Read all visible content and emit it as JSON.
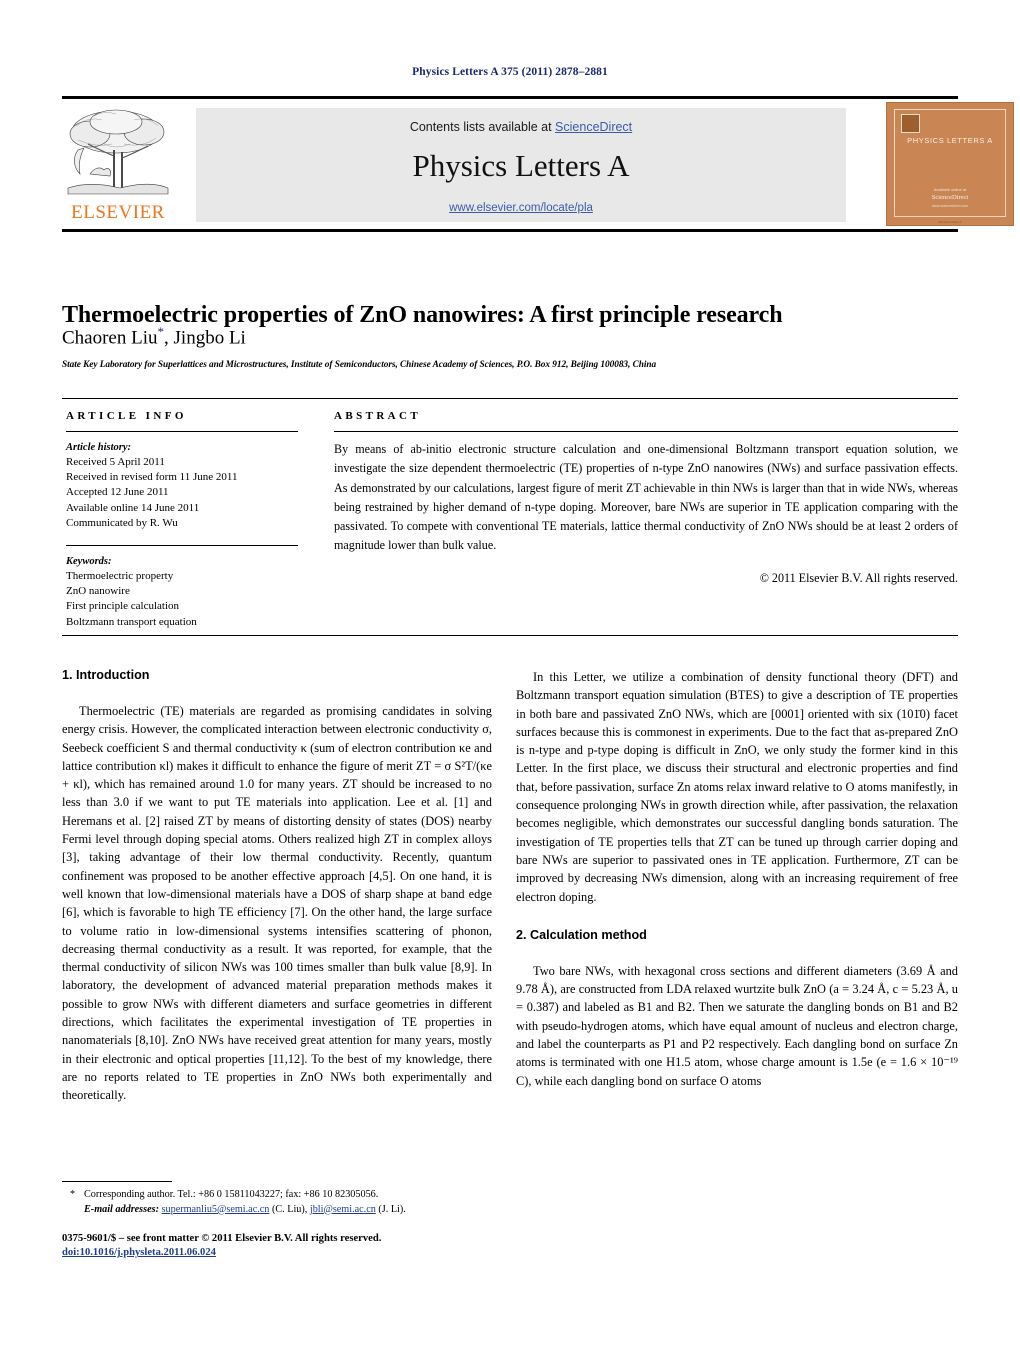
{
  "running_head": "Physics Letters A 375 (2011) 2878–2881",
  "header": {
    "contents_prefix": "Contents lists available at ",
    "sciencedirect": "ScienceDirect",
    "journal_title": "Physics Letters A",
    "journal_url": "www.elsevier.com/locate/pla",
    "publisher_wordmark": "ELSEVIER",
    "cover": {
      "title": "PHYSICS LETTERS A",
      "foot1": "Available online at",
      "foot2": "ScienceDirect",
      "foot3": "www.sciencedirect.com",
      "bottom_bar": "Physics Letters A"
    },
    "accent_color": "#3b5aa8",
    "elsevier_orange": "#e87722",
    "band_gray": "#e8e8e8",
    "cover_orange": "#c98553"
  },
  "article": {
    "title": "Thermoelectric properties of ZnO nanowires: A first principle research",
    "authors": "Chaoren Liu",
    "corresponding_marker": "*",
    "authors_rest": ", Jingbo Li",
    "affiliation": "State Key Laboratory for Superlattices and Microstructures, Institute of Semiconductors, Chinese Academy of Sciences, P.O. Box 912, Beijing 100083, China"
  },
  "article_info": {
    "heading": "ARTICLE INFO",
    "history_label": "Article history:",
    "history": [
      "Received 5 April 2011",
      "Received in revised form 11 June 2011",
      "Accepted 12 June 2011",
      "Available online 14 June 2011",
      "Communicated by R. Wu"
    ],
    "keywords_label": "Keywords:",
    "keywords": [
      "Thermoelectric property",
      "ZnO nanowire",
      "First principle calculation",
      "Boltzmann transport equation"
    ]
  },
  "abstract": {
    "heading": "ABSTRACT",
    "text": "By means of ab-initio electronic structure calculation and one-dimensional Boltzmann transport equation solution, we investigate the size dependent thermoelectric (TE) properties of n-type ZnO nanowires (NWs) and surface passivation effects. As demonstrated by our calculations, largest figure of merit ZT achievable in thin NWs is larger than that in wide NWs, whereas being restrained by higher demand of n-type doping. Moreover, bare NWs are superior in TE application comparing with the passivated. To compete with conventional TE materials, lattice thermal conductivity of ZnO NWs should be at least 2 orders of magnitude lower than bulk value.",
    "copyright": "© 2011 Elsevier B.V. All rights reserved."
  },
  "sections": {
    "introduction_heading": "1. Introduction",
    "intro_p1": "Thermoelectric (TE) materials are regarded as promising candidates in solving energy crisis. However, the complicated interaction between electronic conductivity σ, Seebeck coefficient S and thermal conductivity κ (sum of electron contribution κe and lattice contribution κl) makes it difficult to enhance the figure of merit ZT = σ S²T/(κe + κl), which has remained around 1.0 for many years. ZT should be increased to no less than 3.0 if we want to put TE materials into application. Lee et al. [1] and Heremans et al. [2] raised ZT by means of distorting density of states (DOS) nearby Fermi level through doping special atoms. Others realized high ZT in complex alloys [3], taking advantage of their low thermal conductivity. Recently, quantum confinement was proposed to be another effective approach [4,5]. On one hand, it is well known that low-dimensional materials have a DOS of sharp shape at band edge [6], which is favorable to high TE efficiency [7]. On the other hand, the large surface to volume ratio in low-dimensional systems intensifies scattering of phonon, decreasing thermal conductivity as a result. It was reported, for example, that the thermal conductivity of silicon NWs was 100 times smaller than bulk value [8,9]. In laboratory, the development of advanced material preparation methods makes it possible to grow NWs with different diameters and surface geometries in different directions, which facilitates the experimental investigation of TE properties in nanomaterials [8,10]. ZnO NWs have received great attention for many years, mostly in their electronic and optical properties [11,12]. To the best of my knowledge, there are no reports related to TE properties in ZnO NWs both experimentally and theoretically.",
    "intro_p2": "In this Letter, we utilize a combination of density functional theory (DFT) and Boltzmann transport equation simulation (BTES) to give a description of TE properties in both bare and passivated ZnO NWs, which are [0001] oriented with six (101̄0) facet surfaces because this is commonest in experiments. Due to the fact that as-prepared ZnO is n-type and p-type doping is difficult in ZnO, we only study the former kind in this Letter. In the first place, we discuss their structural and electronic properties and find that, before passivation, surface Zn atoms relax inward relative to O atoms manifestly, in consequence prolonging NWs in growth direction while, after passivation, the relaxation becomes negligible, which demonstrates our successful dangling bonds saturation. The investigation of TE properties tells that ZT can be tuned up through carrier doping and bare NWs are superior to passivated ones in TE application. Furthermore, ZT can be improved by decreasing NWs dimension, along with an increasing requirement of free electron doping.",
    "calculation_heading": "2. Calculation method",
    "calc_p1": "Two bare NWs, with hexagonal cross sections and different diameters (3.69 Å and 9.78 Å), are constructed from LDA relaxed wurtzite bulk ZnO (a = 3.24 Å, c = 5.23 Å, u = 0.387) and labeled as B1 and B2. Then we saturate the dangling bonds on B1 and B2 with pseudo-hydrogen atoms, which have equal amount of nucleus and electron charge, and label the counterparts as P1 and P2 respectively. Each dangling bond on surface Zn atoms is terminated with one H1.5 atom, whose charge amount is 1.5e (e = 1.6 × 10⁻¹⁹ C), while each dangling bond on surface O atoms"
  },
  "footnote": {
    "star": "*",
    "corresponding": "Corresponding author. Tel.: +86 0 15811043227; fax: +86 10 82305056.",
    "email_label": "E-mail addresses:",
    "email1": "supermanliu5@semi.ac.cn",
    "email1_who": "(C. Liu),",
    "email2": "jbli@semi.ac.cn",
    "email2_who": "(J. Li)."
  },
  "imprint": {
    "line1": "0375-9601/$ – see front matter © 2011 Elsevier B.V. All rights reserved.",
    "doi": "doi:10.1016/j.physleta.2011.06.024"
  }
}
